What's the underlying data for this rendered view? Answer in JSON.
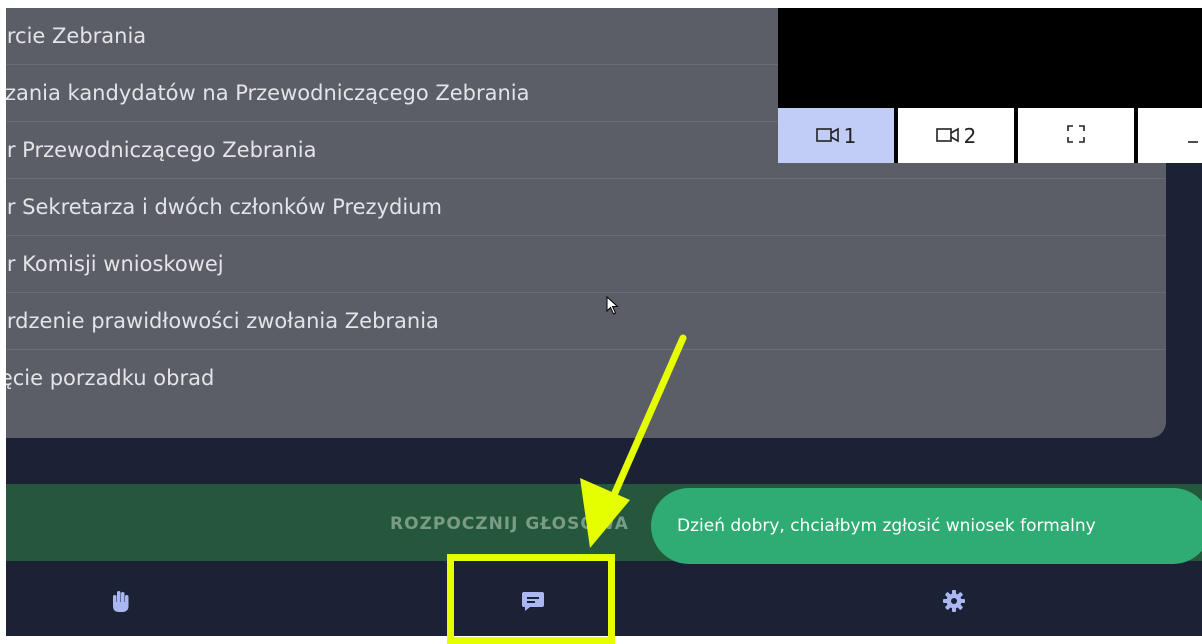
{
  "agenda": {
    "items": [
      "arcie Zebrania",
      "szania kandydatów na Przewodniczącego Zebrania",
      "ór Przewodniczącego Zebrania",
      "ór Sekretarza i dwóch członków Prezydium",
      "ór Komisji wnioskowej",
      "erdzenie prawidłowości zwołania Zebrania",
      "jęcie porzadku obrad"
    ]
  },
  "video": {
    "tabs": [
      {
        "label": "1",
        "icon": "camera-icon",
        "active": true
      },
      {
        "label": "2",
        "icon": "camera-icon",
        "active": false
      },
      {
        "label": "",
        "icon": "fullscreen-icon",
        "active": false
      },
      {
        "label": "",
        "icon": "minimize-icon",
        "active": false
      }
    ]
  },
  "actions": {
    "start_vote_label": "ROZPOCZNIJ GŁOSOWA"
  },
  "toast": {
    "message": "Dzień dobry, chciałbym zgłosić wniosek formalny"
  },
  "bottom_nav": {
    "items": [
      {
        "icon": "raise-hand-icon"
      },
      {
        "icon": "chat-icon"
      },
      {
        "icon": "settings-gear-icon"
      }
    ]
  },
  "colors": {
    "background": "#1c2235",
    "agenda_panel": "#5b5e67",
    "active_tab": "#c2cdf6",
    "vote_bar": "#24573b",
    "toast": "#2eac73",
    "nav_icon": "#aab7f0",
    "annotation": "#e6ff00"
  }
}
